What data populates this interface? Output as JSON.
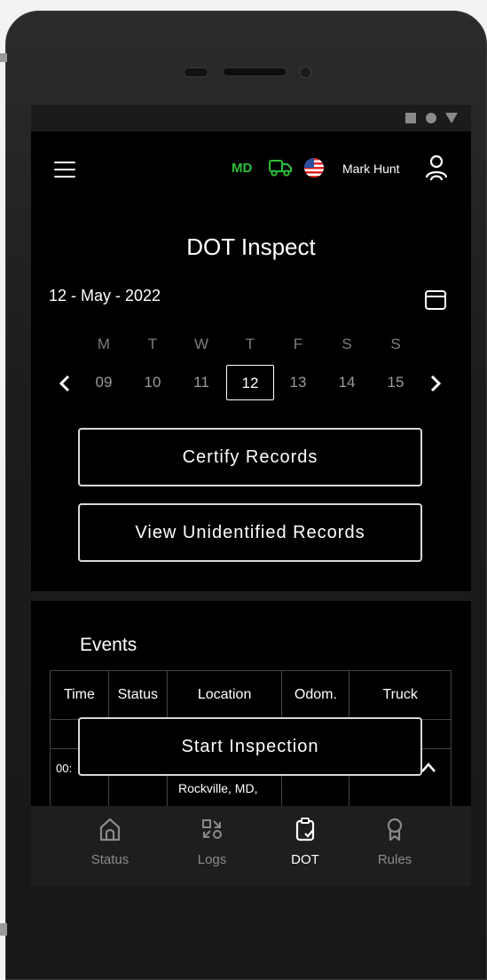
{
  "header": {
    "state_code": "MD",
    "user_name": "Mark Hunt"
  },
  "page": {
    "title": "DOT Inspect",
    "date_label": "12 - May - 2022"
  },
  "week": {
    "days": [
      "M",
      "T",
      "W",
      "T",
      "F",
      "S",
      "S"
    ],
    "dates": [
      "09",
      "10",
      "11",
      "12",
      "13",
      "14",
      "15"
    ],
    "selected_date": "12"
  },
  "actions": {
    "certify_label": "Certify Records",
    "unidentified_label": "View Unidentified Records",
    "start_inspection_label": "Start Inspection"
  },
  "events": {
    "title": "Events",
    "columns": [
      "Time",
      "Status",
      "Location",
      "Odom.",
      "Truck"
    ],
    "rows": [
      {
        "time": "00:",
        "location": "Rockville, MD,"
      }
    ]
  },
  "bottom_nav": {
    "items": [
      {
        "label": "Status",
        "icon": "home-icon"
      },
      {
        "label": "Logs",
        "icon": "logs-icon"
      },
      {
        "label": "DOT",
        "icon": "clipboard-check-icon"
      },
      {
        "label": "Rules",
        "icon": "ribbon-icon"
      }
    ],
    "active": "DOT"
  },
  "colors": {
    "accent_green": "#2fbf3a",
    "screen_bg": "#000000",
    "nav_bg": "#1e1e1e"
  }
}
